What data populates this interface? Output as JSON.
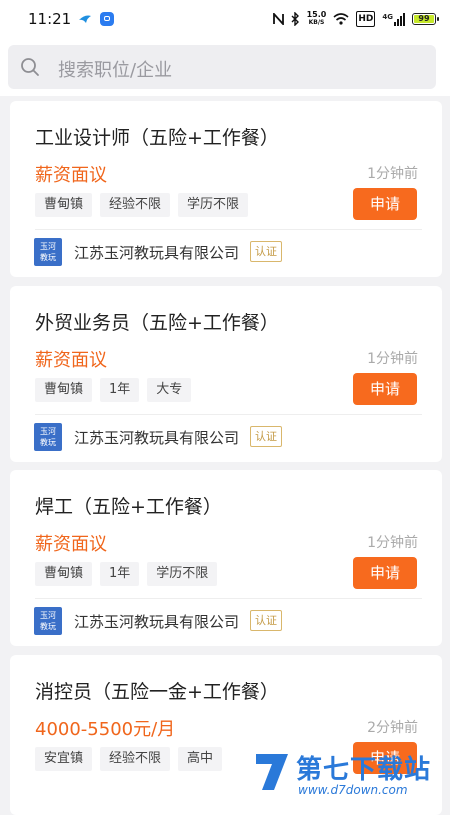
{
  "status_bar": {
    "time": "11:21",
    "network_speed_value": "15.0",
    "network_speed_unit": "KB/S",
    "hd_label": "HD",
    "signal_label": "4G",
    "battery": "99"
  },
  "search": {
    "placeholder": "搜索职位/企业"
  },
  "jobs": [
    {
      "title": "工业设计师（五险+工作餐）",
      "salary": "薪资面议",
      "time_ago": "1分钟前",
      "tags": [
        "曹甸镇",
        "经验不限",
        "学历不限"
      ],
      "apply_label": "申请",
      "company_logo": [
        "玉河",
        "教玩"
      ],
      "company": "江苏玉河教玩具有限公司",
      "verified": "认证"
    },
    {
      "title": "外贸业务员（五险+工作餐）",
      "salary": "薪资面议",
      "time_ago": "1分钟前",
      "tags": [
        "曹甸镇",
        "1年",
        "大专"
      ],
      "apply_label": "申请",
      "company_logo": [
        "玉河",
        "教玩"
      ],
      "company": "江苏玉河教玩具有限公司",
      "verified": "认证"
    },
    {
      "title": "焊工（五险+工作餐）",
      "salary": "薪资面议",
      "time_ago": "1分钟前",
      "tags": [
        "曹甸镇",
        "1年",
        "学历不限"
      ],
      "apply_label": "申请",
      "company_logo": [
        "玉河",
        "教玩"
      ],
      "company": "江苏玉河教玩具有限公司",
      "verified": "认证"
    },
    {
      "title": "消控员（五险一金+工作餐）",
      "salary": "4000-5500元/月",
      "time_ago": "2分钟前",
      "tags": [
        "安宜镇",
        "经验不限",
        "高中"
      ],
      "apply_label": "申请"
    }
  ],
  "watermark": {
    "title": "第七下载站",
    "url": "www.d7down.com"
  },
  "colors": {
    "accent": "#f76a1e",
    "salary": "#f0661c",
    "logo_bg": "#3a6fc8",
    "watermark": "#2a79d9"
  }
}
